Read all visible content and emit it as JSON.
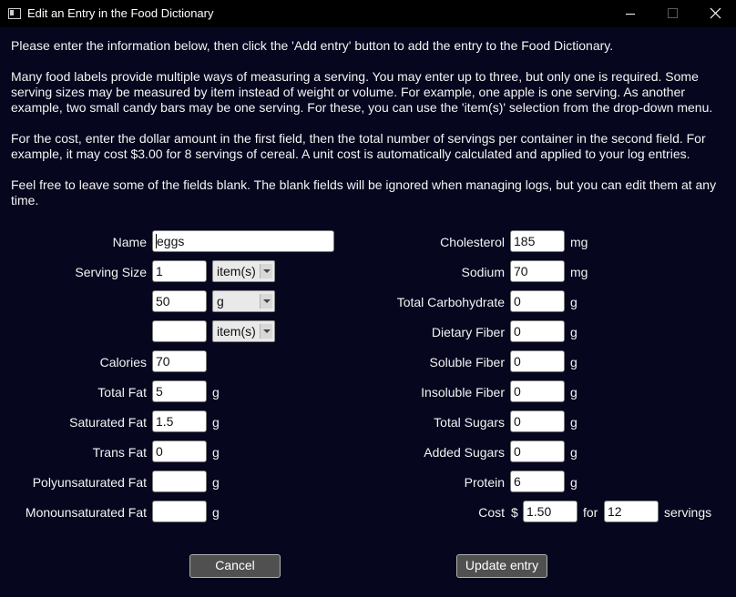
{
  "window": {
    "title": "Edit an Entry in the Food Dictionary"
  },
  "instructions": {
    "p1": "Please enter the information below, then click the 'Add entry' button to add the entry to the Food Dictionary.",
    "p2": "Many food labels provide multiple ways of measuring a serving. You may enter up to three, but only one is required. Some serving sizes may be measured by item instead of weight or volume. For example, one apple is one serving. As another example, two small candy bars may be one serving. For these, you can use the 'item(s)' selection from the drop-down menu.",
    "p3": "For the cost, enter the dollar amount in the first field, then the total number of servings per container in the second field. For example, it may cost $3.00 for 8 servings of cereal. A unit cost is automatically calculated and applied to your log entries.",
    "p4": "Feel free to leave some of the fields blank. The blank fields will be ignored when managing logs, but you can edit them at any time."
  },
  "left": {
    "name": {
      "label": "Name",
      "value": "eggs"
    },
    "serving_size": {
      "label": "Serving Size",
      "rows": [
        {
          "amount": "1",
          "unit": "item(s)"
        },
        {
          "amount": "50",
          "unit": "g"
        },
        {
          "amount": "",
          "unit": "item(s)"
        }
      ]
    },
    "calories": {
      "label": "Calories",
      "value": "70"
    },
    "total_fat": {
      "label": "Total Fat",
      "value": "5",
      "unit": "g"
    },
    "saturated_fat": {
      "label": "Saturated Fat",
      "value": "1.5",
      "unit": "g"
    },
    "trans_fat": {
      "label": "Trans Fat",
      "value": "0",
      "unit": "g"
    },
    "polyunsaturated_fat": {
      "label": "Polyunsaturated Fat",
      "value": "",
      "unit": "g"
    },
    "monounsaturated_fat": {
      "label": "Monounsaturated Fat",
      "value": "",
      "unit": "g"
    }
  },
  "right": {
    "cholesterol": {
      "label": "Cholesterol",
      "value": "185",
      "unit": "mg"
    },
    "sodium": {
      "label": "Sodium",
      "value": "70",
      "unit": "mg"
    },
    "total_carbohydrate": {
      "label": "Total Carbohydrate",
      "value": "0",
      "unit": "g"
    },
    "dietary_fiber": {
      "label": "Dietary Fiber",
      "value": "0",
      "unit": "g"
    },
    "soluble_fiber": {
      "label": "Soluble Fiber",
      "value": "0",
      "unit": "g"
    },
    "insoluble_fiber": {
      "label": "Insoluble Fiber",
      "value": "0",
      "unit": "g"
    },
    "total_sugars": {
      "label": "Total Sugars",
      "value": "0",
      "unit": "g"
    },
    "added_sugars": {
      "label": "Added Sugars",
      "value": "0",
      "unit": "g"
    },
    "protein": {
      "label": "Protein",
      "value": "6",
      "unit": "g"
    },
    "cost": {
      "label": "Cost",
      "currency": "$",
      "amount": "1.50",
      "for_label": "for",
      "servings": "12",
      "servings_label": "servings"
    }
  },
  "buttons": {
    "cancel": "Cancel",
    "update": "Update entry"
  },
  "colors": {
    "window_background": "#06061e",
    "titlebar_background": "#000000",
    "text": "#f4f4f4",
    "button_background": "#505050"
  },
  "icons": {
    "app": "window-icon",
    "minimize": "minimize-icon",
    "maximize": "maximize-icon",
    "close": "close-icon"
  }
}
